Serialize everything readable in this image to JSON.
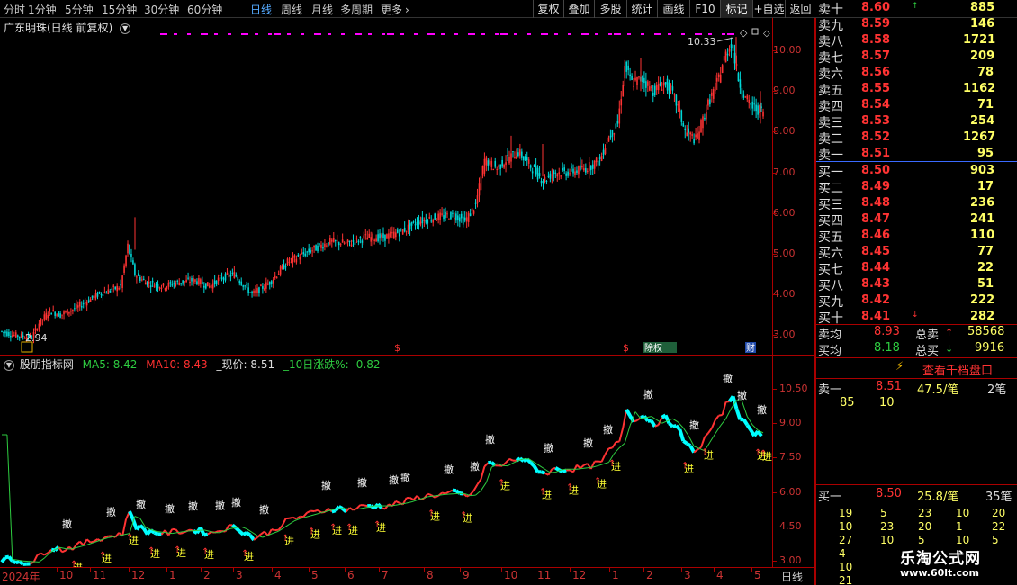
{
  "toolbar": {
    "periods": [
      "分时",
      "1分钟",
      "5分钟",
      "15分钟",
      "30分钟",
      "60分钟",
      "日线",
      "周线",
      "月线",
      "多周期",
      "更多"
    ],
    "active_period": "日线",
    "right_buttons": [
      "复权",
      "叠加",
      "多股",
      "统计",
      "画线",
      "F10",
      "标记",
      "+自选",
      "返回"
    ]
  },
  "chart": {
    "title": "广东明珠(日线 前复权)",
    "price_ticks": [
      "10.00",
      "9.00",
      "8.00",
      "7.00",
      "6.00",
      "5.00",
      "4.00",
      "3.00"
    ],
    "high_label": "10.33",
    "low_label": "2.94",
    "event_marks": [
      "$",
      "$",
      "除权",
      "财"
    ]
  },
  "indicator": {
    "name": "股朋指标网",
    "legend": [
      {
        "label": "MA5: 8.42",
        "color": "#2ecc40"
      },
      {
        "label": "MA10: 8.43",
        "color": "#ff3030"
      },
      {
        "label": "_现价: 8.51",
        "color": "#dddddd"
      },
      {
        "label": "_10日涨跌%: -0.82",
        "color": "#2ecc40"
      }
    ],
    "ticks": [
      "10.50",
      "9.00",
      "7.50",
      "6.00",
      "4.50",
      "3.00"
    ],
    "sell_mark": "撤",
    "buy_mark": "进"
  },
  "time_axis": {
    "labels": [
      "2024年",
      "10",
      "11",
      "12",
      "1",
      "2",
      "3",
      "4",
      "5",
      "6",
      "7",
      "8",
      "9",
      "10",
      "11",
      "12",
      "1",
      "2",
      "3",
      "4",
      "5"
    ],
    "period": "日线"
  },
  "orderbook": {
    "asks": [
      {
        "label": "卖十",
        "price": "8.60",
        "vol": "885"
      },
      {
        "label": "卖九",
        "price": "8.59",
        "vol": "146"
      },
      {
        "label": "卖八",
        "price": "8.58",
        "vol": "1721"
      },
      {
        "label": "卖七",
        "price": "8.57",
        "vol": "209"
      },
      {
        "label": "卖六",
        "price": "8.56",
        "vol": "78"
      },
      {
        "label": "卖五",
        "price": "8.55",
        "vol": "1162"
      },
      {
        "label": "卖四",
        "price": "8.54",
        "vol": "71"
      },
      {
        "label": "卖三",
        "price": "8.53",
        "vol": "254"
      },
      {
        "label": "卖二",
        "price": "8.52",
        "vol": "1267"
      },
      {
        "label": "卖一",
        "price": "8.51",
        "vol": "95"
      }
    ],
    "bids": [
      {
        "label": "买一",
        "price": "8.50",
        "vol": "903"
      },
      {
        "label": "买二",
        "price": "8.49",
        "vol": "17"
      },
      {
        "label": "买三",
        "price": "8.48",
        "vol": "236"
      },
      {
        "label": "买四",
        "price": "8.47",
        "vol": "241"
      },
      {
        "label": "买五",
        "price": "8.46",
        "vol": "110"
      },
      {
        "label": "买六",
        "price": "8.45",
        "vol": "77"
      },
      {
        "label": "买七",
        "price": "8.44",
        "vol": "22"
      },
      {
        "label": "买八",
        "price": "8.43",
        "vol": "51"
      },
      {
        "label": "买九",
        "price": "8.42",
        "vol": "222"
      },
      {
        "label": "买十",
        "price": "8.41",
        "vol": "282"
      }
    ],
    "avg_sell": {
      "label": "卖均",
      "price": "8.93",
      "total_label": "总卖",
      "total": "58568"
    },
    "avg_buy": {
      "label": "买均",
      "price": "8.18",
      "total_label": "总买",
      "total": "9916"
    },
    "thousand_level_button": "查看千档盘口",
    "sell1_detail": {
      "label": "卖一",
      "price": "8.51",
      "avg": "47.5/笔",
      "count": "2笔"
    },
    "sell1_orders": [
      "85",
      "10"
    ],
    "buy1_detail": {
      "label": "买一",
      "price": "8.50",
      "avg": "25.8/笔",
      "count": "35笔"
    },
    "buy1_orders": [
      [
        "19",
        "5",
        "23",
        "10",
        "20"
      ],
      [
        "10",
        "23",
        "20",
        "1",
        "22"
      ],
      [
        "27",
        "10",
        "5",
        "10",
        "5"
      ],
      [
        "4",
        "",
        "",
        "",
        ""
      ],
      [
        "10",
        "",
        "",
        "",
        ""
      ],
      [
        "21",
        "",
        "",
        "",
        ""
      ]
    ]
  },
  "watermark": {
    "name": "乐淘公式网",
    "url": "www.60lt.com"
  },
  "colors": {
    "up": "#ff3333",
    "down": "#00d7d7",
    "frame": "#a00000",
    "blue": "#5aaaff",
    "magenta": "#ff00ff",
    "yellow": "#ffff33"
  }
}
